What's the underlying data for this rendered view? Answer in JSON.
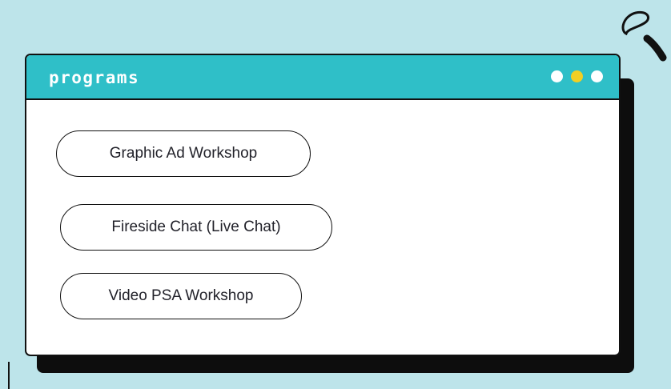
{
  "window": {
    "title": "programs",
    "dots": [
      {
        "name": "dot-white-1",
        "color": "#ffffff"
      },
      {
        "name": "dot-yellow",
        "color": "#f3cf23"
      },
      {
        "name": "dot-white-2",
        "color": "#ffffff"
      }
    ]
  },
  "programs": [
    {
      "label": "Graphic Ad Workshop"
    },
    {
      "label": "Fireside Chat (Live Chat)"
    },
    {
      "label": "Video PSA Workshop"
    }
  ],
  "colors": {
    "background": "#bde4ea",
    "titlebar": "#2fbfc8",
    "accent_yellow": "#f3cf23",
    "shadow": "#0d0d0d"
  }
}
